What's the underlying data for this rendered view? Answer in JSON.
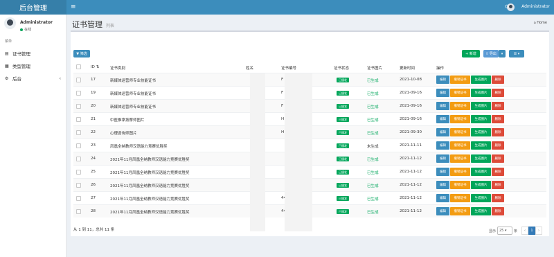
{
  "app": {
    "title": "后台管理"
  },
  "topbar": {
    "username": "Administrator"
  },
  "sidebar": {
    "user_name": "Administrator",
    "user_status": "在线",
    "header": "菜单",
    "items": [
      {
        "label": "证书管理",
        "icon": "certificate-icon"
      },
      {
        "label": "类型管理",
        "icon": "category-icon"
      },
      {
        "label": "后台",
        "icon": "gear-icon"
      }
    ]
  },
  "page": {
    "title": "证书管理",
    "subtitle": "列表",
    "breadcrumb": "Home"
  },
  "toolbar": {
    "filter_label": "筛选",
    "add_label": "+ 新增",
    "export_label": "导出"
  },
  "table": {
    "headers": [
      "ID",
      "证书类别",
      "姓名",
      "证书编号",
      "证书状态",
      "证书图片",
      "更新时间",
      "操作"
    ],
    "status_badge": "已颁发",
    "ops": [
      "编辑",
      "撤销证书",
      "生成图片",
      "删除"
    ],
    "rows": [
      {
        "id": "17",
        "type": "新媒体运营师专业技能证书",
        "name": "",
        "number": "F",
        "img": "已生成",
        "time": "2021-10-08"
      },
      {
        "id": "19",
        "type": "新媒体运营师专业技能证书",
        "name": "",
        "number": "F",
        "img": "已生成",
        "time": "2021-09-16"
      },
      {
        "id": "20",
        "type": "新媒体运营师专业技能证书",
        "name": "",
        "number": "F",
        "img": "已生成",
        "time": "2021-09-16"
      },
      {
        "id": "21",
        "type": "中医推拿按摩师图片",
        "name": "",
        "number": "H",
        "img": "已生成",
        "time": "2021-09-16"
      },
      {
        "id": "22",
        "type": "心理咨询师图片",
        "name": "",
        "number": "H",
        "img": "已生成",
        "time": "2021-09-30"
      },
      {
        "id": "23",
        "type": "凤凰全纳教师汉语能力竞赛优胜奖",
        "name": "",
        "number": "",
        "img": "未生成",
        "time": "2021-11-11"
      },
      {
        "id": "24",
        "type": "2021年11月凤凰全纳教师汉语能力竞赛优胜奖",
        "name": "",
        "number": "",
        "img": "已生成",
        "time": "2021-11-12"
      },
      {
        "id": "25",
        "type": "2021年11月凤凰全纳教师汉语能力竞赛优胜奖",
        "name": "",
        "number": "",
        "img": "已生成",
        "time": "2021-11-12"
      },
      {
        "id": "26",
        "type": "2021年11月凤凰全纳教师汉语能力竞赛优胜奖",
        "name": "",
        "number": "",
        "img": "已生成",
        "time": "2021-11-12"
      },
      {
        "id": "27",
        "type": "2021年11月凤凰全纳教师汉语能力竞赛优胜奖",
        "name": "",
        "number": "44",
        "img": "已生成",
        "time": "2021-11-12"
      },
      {
        "id": "28",
        "type": "2021年11月凤凰全纳教师汉语能力竞赛优胜奖",
        "name": "",
        "number": "44",
        "img": "已生成",
        "time": "2021-11-12"
      }
    ]
  },
  "footer": {
    "summary": "从 1 到 11，总共 11 条",
    "page_size_label": "显示",
    "page_size": "25",
    "page_size_suffix": "条",
    "current_page": "1",
    "prev": "‹",
    "next": "›"
  }
}
